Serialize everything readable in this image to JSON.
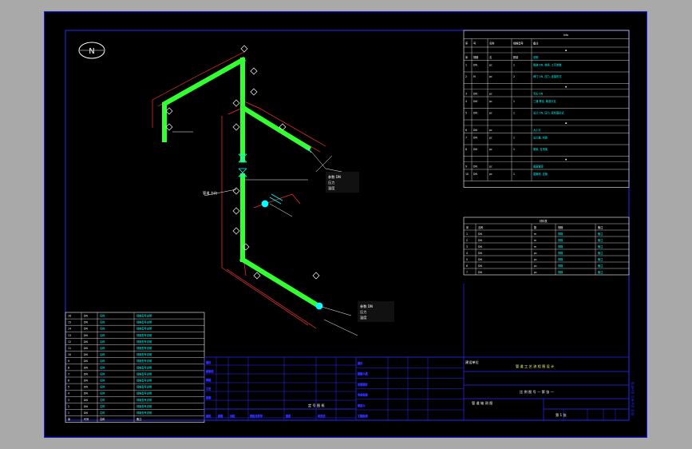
{
  "north_symbol": {
    "label": "N"
  },
  "process_table": {
    "title": "Info",
    "headers": [
      "序",
      "号",
      "名称",
      "规格型号",
      "备注"
    ],
    "rows": [
      [
        "序",
        "规格",
        "名",
        "数量",
        "说明"
      ],
      [
        "1",
        "DN",
        "pc",
        "1",
        "管道 DN, 材质, 工艺参数"
      ],
      [
        "2",
        "M",
        "pc",
        "2",
        "阀门 DN, 压力, 连接形式"
      ],
      [
        "3",
        "DN",
        "pc",
        "",
        "弯头 DN"
      ],
      [
        "4",
        "DN",
        "pc",
        "1",
        "三通 等径, 管道分支"
      ],
      [
        "5",
        "DN",
        "pc",
        "1",
        "法兰 DN, 压力, 密封面形式"
      ],
      [
        "6",
        "DN",
        "pc",
        "",
        "大小头"
      ],
      [
        "7",
        "DN",
        "pc",
        "1",
        "法兰盖, 材质"
      ],
      [
        "8",
        "DN",
        "pc",
        "1",
        "管架, 支吊架"
      ],
      [
        "9",
        "DN",
        "pc",
        "",
        "垂直管段"
      ],
      [
        "10",
        "DN",
        "pc",
        "1",
        "直管段, 支管"
      ]
    ]
  },
  "materials_table": {
    "title": "材料表",
    "headers": [
      "序",
      "名称",
      "数",
      "规格",
      "备注"
    ],
    "rows": [
      [
        "1",
        "DN",
        "m",
        "规格",
        "备注"
      ],
      [
        "2",
        "DN",
        "m",
        "规格",
        "备注"
      ],
      [
        "3",
        "DN",
        "m",
        "规格",
        "备注"
      ],
      [
        "4",
        "DN",
        "pc",
        "规格",
        "备注"
      ],
      [
        "5",
        "DN",
        "pc",
        "规格",
        "备注"
      ],
      [
        "6",
        "DN",
        "pc",
        "规格",
        "备注"
      ],
      [
        "7",
        "DN",
        "pc",
        "规格",
        "备注"
      ]
    ]
  },
  "parts_list": {
    "rows": [
      [
        "16",
        "DN",
        "名称",
        "规格型号说明"
      ],
      [
        "15",
        "DN",
        "名称",
        "规格型号说明"
      ],
      [
        "14",
        "DN",
        "名称",
        "规格型号说明"
      ],
      [
        "13",
        "DN",
        "名称",
        "规格型号说明"
      ],
      [
        "12",
        "DN",
        "名称",
        "规格型号说明"
      ],
      [
        "11",
        "DN",
        "名称",
        "规格型号说明"
      ],
      [
        "10",
        "DN",
        "名称",
        "规格型号说明"
      ],
      [
        "9",
        "DN",
        "名称",
        "规格型号说明"
      ],
      [
        "8",
        "DN",
        "名称",
        "规格型号说明"
      ],
      [
        "7",
        "DN",
        "名称",
        "规格型号说明"
      ],
      [
        "6",
        "DN",
        "名称",
        "规格型号说明"
      ],
      [
        "5",
        "DN",
        "名称",
        "规格型号说明"
      ],
      [
        "4",
        "DN",
        "名称",
        "规格型号说明"
      ],
      [
        "3",
        "DN",
        "名称",
        "规格型号说明"
      ],
      [
        "2",
        "DN",
        "名称",
        "规格型号说明"
      ],
      [
        "1",
        "DN",
        "名称",
        "规格型号说明"
      ]
    ],
    "footer": [
      "序",
      "代号",
      "名称",
      "备注"
    ]
  },
  "title_block": {
    "footer_left": [
      "标记",
      "处数",
      "分区",
      "更改文件号",
      "签名",
      "年月日"
    ],
    "sign_rows": [
      "设计",
      "标准化",
      "审核",
      "工艺",
      "批准"
    ],
    "mid_rows": [
      "设计",
      "校核人员",
      "主管设计",
      "专业负责",
      "审定人",
      "工程负责"
    ],
    "mid_caption": "定 号 图 纸",
    "main_title": "管 道 工 艺 流 程 图 设 计",
    "line2": "比 例 图 号 — 第 张 —",
    "line3": "管 道 轴 测 图",
    "sheet_label": "第 1 张",
    "owner_label": "建设单位",
    "side_stamp": "图号 设计单位 设计阶段"
  },
  "annotations": {
    "main_note": "管道 方向",
    "callout_a": [
      "参数 DN",
      "压力",
      "温度"
    ],
    "callout_b": [
      "参数 DN",
      "压力",
      "温度"
    ]
  }
}
